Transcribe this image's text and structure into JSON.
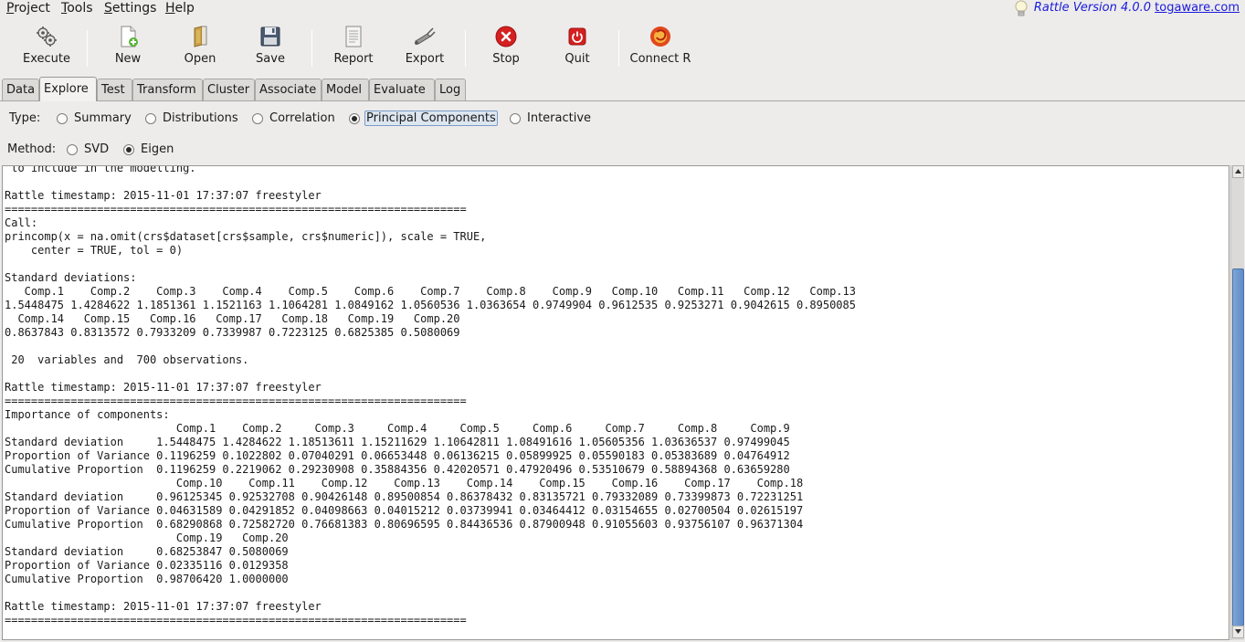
{
  "menu": {
    "items": [
      "Project",
      "Tools",
      "Settings",
      "Help"
    ],
    "underline": [
      "P",
      "T",
      "S",
      "H"
    ],
    "rest": [
      "roject",
      "ools",
      "ettings",
      "elp"
    ]
  },
  "version": {
    "prefix": "Rattle Version 4.0.0",
    "link": "togaware.com"
  },
  "toolbar": {
    "execute": "Execute",
    "new": "New",
    "open": "Open",
    "save": "Save",
    "report": "Report",
    "export": "Export",
    "stop": "Stop",
    "quit": "Quit",
    "connect": "Connect R"
  },
  "tabs": [
    "Data",
    "Explore",
    "Test",
    "Transform",
    "Cluster",
    "Associate",
    "Model",
    "Evaluate",
    "Log"
  ],
  "active_tab": "Explore",
  "type_row": {
    "label": "Type:",
    "options": [
      "Summary",
      "Distributions",
      "Correlation",
      "Principal Components",
      "Interactive"
    ],
    "selected": "Principal Components"
  },
  "method_row": {
    "label": "Method:",
    "options": [
      "SVD",
      "Eigen"
    ],
    "selected": "Eigen"
  },
  "output_text": " to include in the modelling.\n\nRattle timestamp: 2015-11-01 17:37:07 freestyler\n======================================================================\nCall:\nprincomp(x = na.omit(crs$dataset[crs$sample, crs$numeric]), scale = TRUE,\n    center = TRUE, tol = 0)\n\nStandard deviations:\n   Comp.1    Comp.2    Comp.3    Comp.4    Comp.5    Comp.6    Comp.7    Comp.8    Comp.9   Comp.10   Comp.11   Comp.12   Comp.13\n1.5448475 1.4284622 1.1851361 1.1521163 1.1064281 1.0849162 1.0560536 1.0363654 0.9749904 0.9612535 0.9253271 0.9042615 0.8950085\n  Comp.14   Comp.15   Comp.16   Comp.17   Comp.18   Comp.19   Comp.20\n0.8637843 0.8313572 0.7933209 0.7339987 0.7223125 0.6825385 0.5080069\n\n 20  variables and  700 observations.\n\nRattle timestamp: 2015-11-01 17:37:07 freestyler\n======================================================================\nImportance of components:\n                          Comp.1    Comp.2     Comp.3     Comp.4     Comp.5     Comp.6     Comp.7     Comp.8     Comp.9\nStandard deviation     1.5448475 1.4284622 1.18513611 1.15211629 1.10642811 1.08491616 1.05605356 1.03636537 0.97499045\nProportion of Variance 0.1196259 0.1022802 0.07040291 0.06653448 0.06136215 0.05899925 0.05590183 0.05383689 0.04764912\nCumulative Proportion  0.1196259 0.2219062 0.29230908 0.35884356 0.42020571 0.47920496 0.53510679 0.58894368 0.63659280\n                          Comp.10    Comp.11    Comp.12    Comp.13    Comp.14    Comp.15    Comp.16    Comp.17    Comp.18\nStandard deviation     0.96125345 0.92532708 0.90426148 0.89500854 0.86378432 0.83135721 0.79332089 0.73399873 0.72231251\nProportion of Variance 0.04631589 0.04291852 0.04098663 0.04015212 0.03739941 0.03464412 0.03154655 0.02700504 0.02615197\nCumulative Proportion  0.68290868 0.72582720 0.76681383 0.80696595 0.84436536 0.87900948 0.91055603 0.93756107 0.96371304\n                          Comp.19   Comp.20\nStandard deviation     0.68253847 0.5080069\nProportion of Variance 0.02335116 0.0129358\nCumulative Proportion  0.98706420 1.0000000\n\nRattle timestamp: 2015-11-01 17:37:07 freestyler\n======================================================================",
  "colors": {
    "link": "#1a1adc",
    "stop_red": "#d42020",
    "scroll_thumb": "#6b96cc"
  },
  "icons": [
    "execute-icon",
    "new-icon",
    "open-icon",
    "save-icon",
    "report-icon",
    "export-icon",
    "stop-icon",
    "quit-icon",
    "connect-r-icon",
    "lightbulb-icon"
  ]
}
